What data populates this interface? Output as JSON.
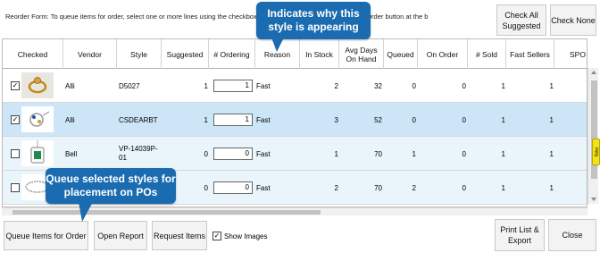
{
  "instructions": "Reorder Form: To queue items for order, select one or more lines using the checkboxes, spec...                                                                                       elect the Queue Items for Order button at the b",
  "top_buttons": {
    "check_all": "Check All Suggested",
    "check_none": "Check None"
  },
  "columns": [
    "Checked",
    "Vendor",
    "Style",
    "Suggested",
    "# Ordering",
    "Reason",
    "In Stock",
    "Avg Days On Hand",
    "Queued",
    "On Order",
    "# Sold",
    "Fast Sellers",
    "SPO"
  ],
  "rows": [
    {
      "checked": "✓",
      "vendor": "Alli",
      "style": "D5027",
      "suggested": "1",
      "ordering": "1",
      "reason": "Fast",
      "in_stock": "2",
      "avg_days": "32",
      "queued": "0",
      "on_order": "0",
      "sold": "1",
      "fast_sellers": "1",
      "thumb": "ring-icon"
    },
    {
      "checked": "✓",
      "vendor": "Alli",
      "style": "CSDEARBT",
      "suggested": "1",
      "ordering": "1",
      "reason": "Fast",
      "in_stock": "3",
      "avg_days": "52",
      "queued": "0",
      "on_order": "0",
      "sold": "1",
      "fast_sellers": "1",
      "thumb": "charm-icon"
    },
    {
      "checked": "",
      "vendor": "Bell",
      "style": "VP-14039P-01",
      "suggested": "0",
      "ordering": "0",
      "reason": "Fast",
      "in_stock": "1",
      "avg_days": "70",
      "queued": "1",
      "on_order": "0",
      "sold": "1",
      "fast_sellers": "1",
      "thumb": "pendant-icon"
    },
    {
      "checked": "",
      "vendor": "",
      "style": "",
      "suggested": "0",
      "ordering": "0",
      "reason": "Fast",
      "in_stock": "2",
      "avg_days": "70",
      "queued": "2",
      "on_order": "0",
      "sold": "1",
      "fast_sellers": "1",
      "thumb": "bracelet-icon"
    }
  ],
  "bottom": {
    "queue": "Queue Items for Order",
    "report": "Open Report",
    "request": "Request Items",
    "show_images_label": "Show Images",
    "show_images_checked": "✓",
    "print": "Print List & Export",
    "close": "Close"
  },
  "callouts": {
    "top": "Indicates why this style is appearing",
    "bottom": "Queue selected styles for placement on POs"
  },
  "side_tab": "Help",
  "colors": {
    "callout": "#1a6bb0",
    "selected_row": "#cde6f7",
    "alt_row": "#e9f4fb"
  }
}
